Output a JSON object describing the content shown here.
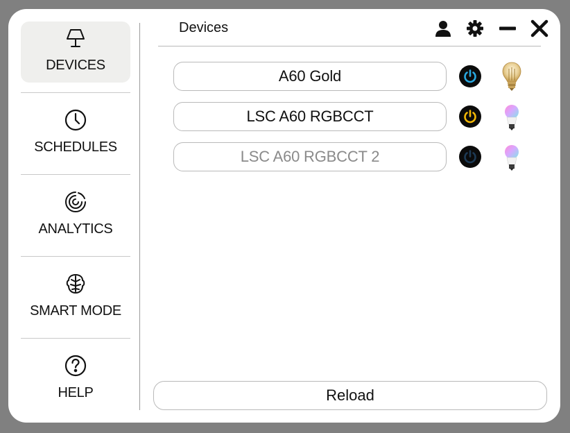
{
  "sidebar": {
    "items": [
      {
        "label": "DEVICES",
        "icon": "lamp-icon",
        "active": true
      },
      {
        "label": "SCHEDULES",
        "icon": "clock-icon",
        "active": false
      },
      {
        "label": "ANALYTICS",
        "icon": "spiral-icon",
        "active": false
      },
      {
        "label": "SMART MODE",
        "icon": "brain-icon",
        "active": false
      },
      {
        "label": "HELP",
        "icon": "help-icon",
        "active": false
      }
    ]
  },
  "header": {
    "title": "Devices",
    "icons": [
      "user-icon",
      "gear-icon",
      "minimize-icon",
      "close-icon"
    ]
  },
  "devices": [
    {
      "name": "A60 Gold",
      "power_color": "#29a8e0",
      "state": "on",
      "bulb": "filament-bulb-icon"
    },
    {
      "name": "LSC A60 RGBCCT",
      "power_color": "#f2b705",
      "state": "on",
      "bulb": "rgb-bulb-icon"
    },
    {
      "name": "LSC A60 RGBCCT 2",
      "power_color": "#1d3a55",
      "state": "off",
      "bulb": "rgb-bulb-icon"
    }
  ],
  "footer": {
    "reload_label": "Reload"
  },
  "colors": {
    "background": "#808080",
    "window": "#ffffff",
    "active_nav": "#efefed"
  }
}
